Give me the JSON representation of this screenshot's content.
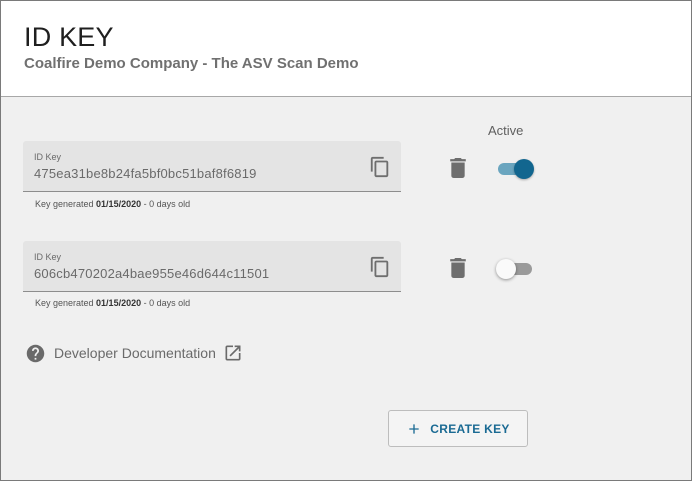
{
  "header": {
    "title": "ID KEY",
    "subtitle": "Coalfire Demo Company - The ASV Scan Demo"
  },
  "columns": {
    "active_label": "Active"
  },
  "keys": [
    {
      "field_label": "ID Key",
      "value": "475ea31be8b24fa5bf0bc51baf8f6819",
      "generated_prefix": "Key generated ",
      "generated_date": "01/15/2020",
      "generated_suffix": " - 0 days old",
      "active": true
    },
    {
      "field_label": "ID Key",
      "value": "606cb470202a4bae955e46d644c11501",
      "generated_prefix": "Key generated ",
      "generated_date": "01/15/2020",
      "generated_suffix": " - 0 days old",
      "active": false
    }
  ],
  "docs": {
    "link_text": "Developer Documentation",
    "icon": "help-circle-icon",
    "external_icon": "open-in-new-icon"
  },
  "actions": {
    "create_label": "CREATE KEY",
    "create_icon": "plus-icon"
  },
  "colors": {
    "accent": "#12668f",
    "toggle_on_track": "#6aa5bf",
    "button_text": "#1a6a93"
  }
}
